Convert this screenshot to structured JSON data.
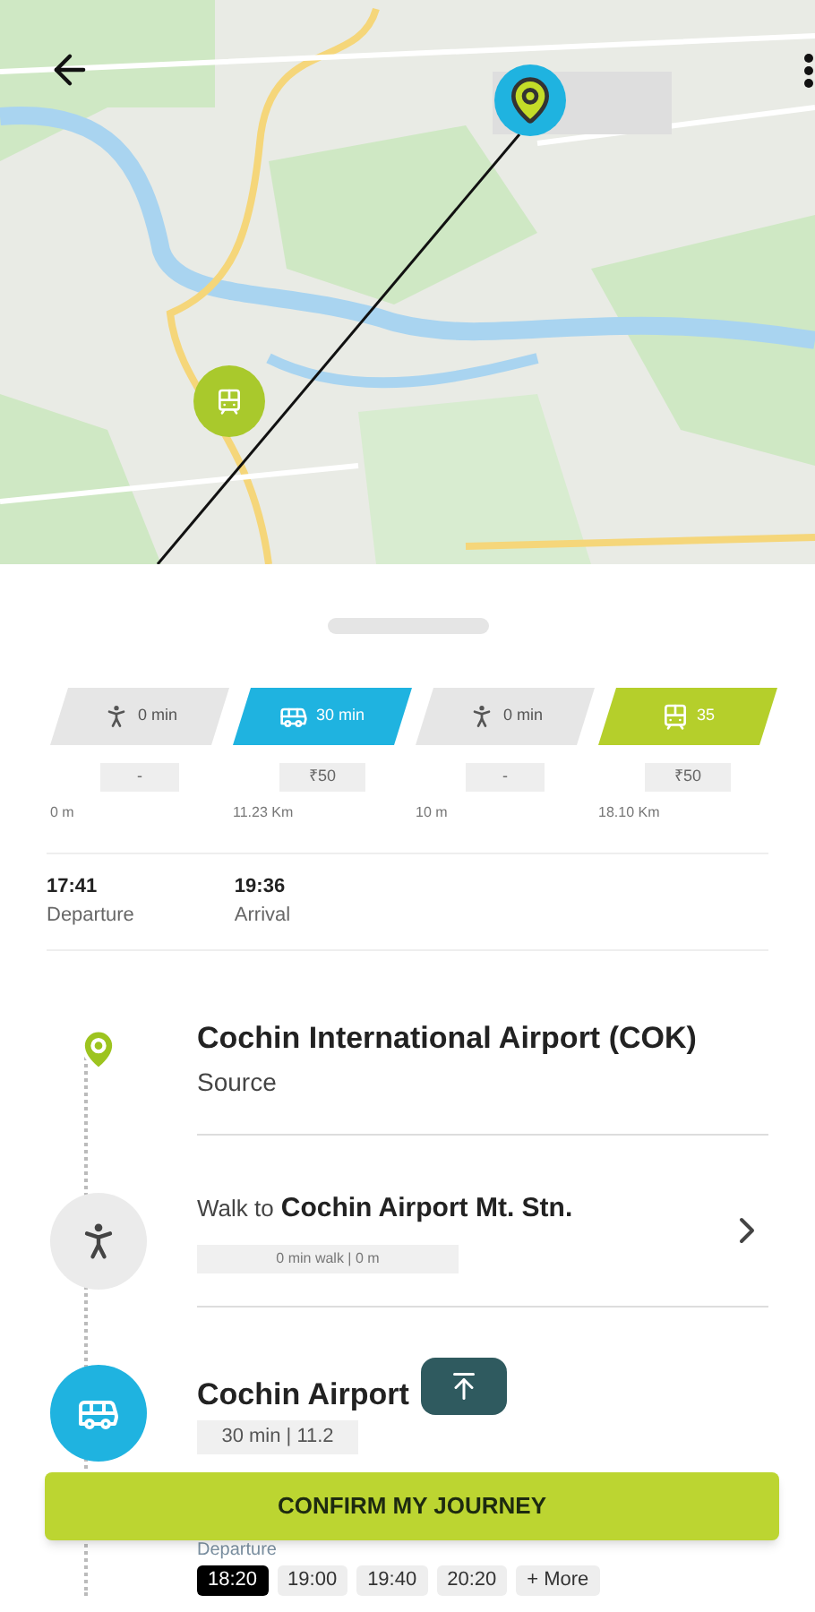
{
  "segments": [
    {
      "kind": "walk",
      "duration": "0 min",
      "fare": "-",
      "distance": "0 m"
    },
    {
      "kind": "bus",
      "duration": "30 min",
      "fare": "₹50",
      "distance": "11.23 Km"
    },
    {
      "kind": "walk",
      "duration": "0 min",
      "fare": "-",
      "distance": "10 m"
    },
    {
      "kind": "metro",
      "duration": "35",
      "fare": "₹50",
      "distance": "18.10 Km"
    }
  ],
  "times": [
    {
      "time": "17:41",
      "label": "Departure"
    },
    {
      "time": "19:36",
      "label": "Arrival"
    }
  ],
  "stops": [
    {
      "kind": "source",
      "title": "Cochin International Airport (COK)",
      "subtitle": "Source"
    },
    {
      "kind": "walk",
      "prefix": "Walk to",
      "title": "Cochin Airport Mt. Stn.",
      "chip": "0 min walk | 0 m"
    },
    {
      "kind": "bus",
      "title": "Cochin Airport",
      "chip": "30 min | 11.2",
      "departure_label": "Departure",
      "departures": [
        {
          "time": "18:20",
          "selected": true
        },
        {
          "time": "19:00",
          "selected": false
        },
        {
          "time": "19:40",
          "selected": false
        },
        {
          "time": "20:20",
          "selected": false
        },
        {
          "time": "+ More",
          "selected": false
        }
      ]
    }
  ],
  "confirm_button": "CONFIRM MY JOURNEY"
}
